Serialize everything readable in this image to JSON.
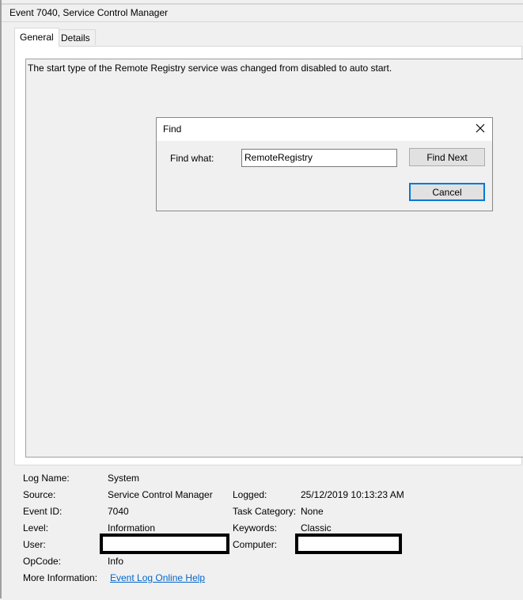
{
  "window": {
    "title": "Event 7040, Service Control Manager"
  },
  "tabs": [
    {
      "label": "General"
    },
    {
      "label": "Details"
    }
  ],
  "message": "The start type of the Remote Registry service was changed from disabled to auto start.",
  "find_dialog": {
    "title": "Find",
    "find_what_label": "Find what:",
    "find_what_value": "RemoteRegistry",
    "find_next_label": "Find Next",
    "cancel_label": "Cancel"
  },
  "details": {
    "log_name_label": "Log Name:",
    "log_name": "System",
    "source_label": "Source:",
    "source": "Service Control Manager",
    "logged_label": "Logged:",
    "logged": "25/12/2019 10:13:23 AM",
    "event_id_label": "Event ID:",
    "event_id": "7040",
    "task_category_label": "Task Category:",
    "task_category": "None",
    "level_label": "Level:",
    "level": "Information",
    "keywords_label": "Keywords:",
    "keywords": "Classic",
    "user_label": "User:",
    "user": "",
    "computer_label": "Computer:",
    "computer": "",
    "opcode_label": "OpCode:",
    "opcode": "Info",
    "more_info_label": "More Information:",
    "more_info_link": "Event Log Online Help"
  }
}
